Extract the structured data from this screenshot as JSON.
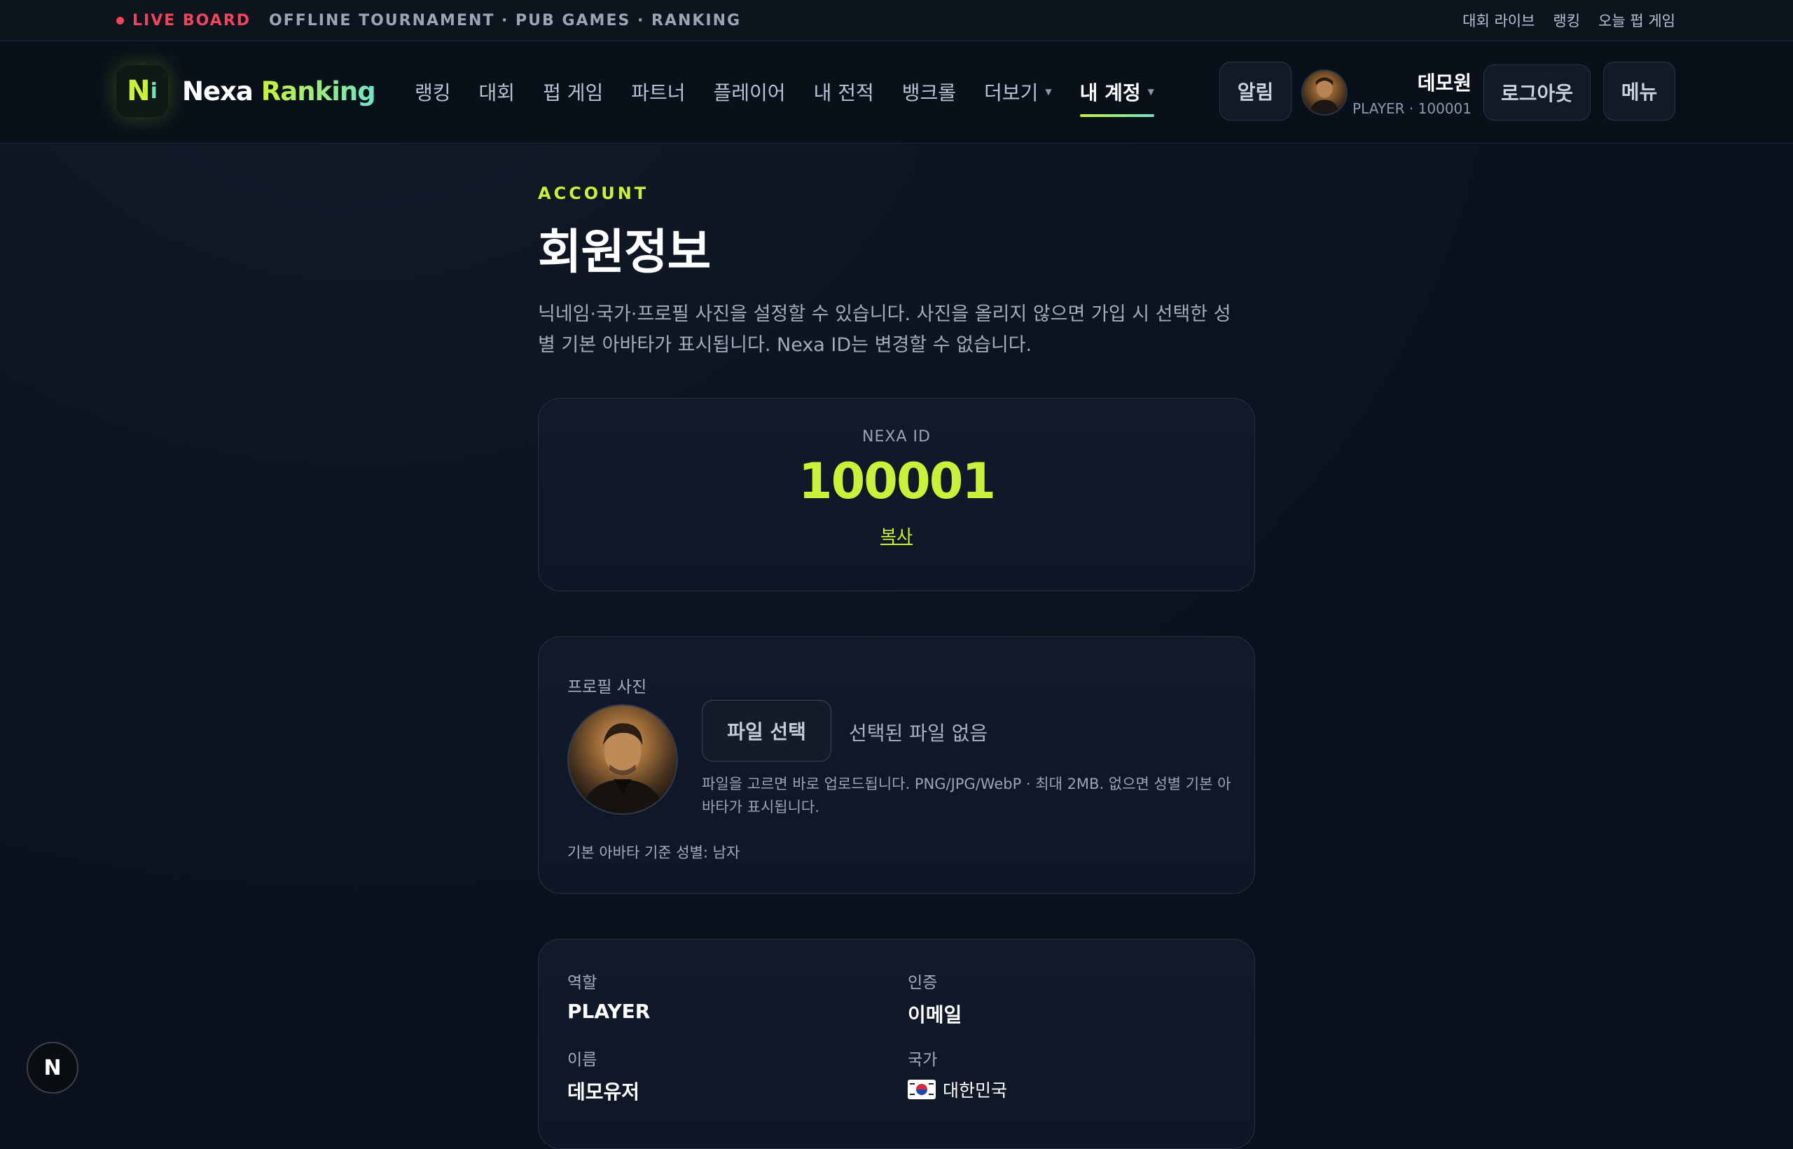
{
  "topbar": {
    "live_label": "LIVE BOARD",
    "ticker": "OFFLINE TOURNAMENT · PUB GAMES · RANKING",
    "links": [
      "대회 라이브",
      "랭킹",
      "오늘 펍 게임"
    ]
  },
  "header": {
    "logo_mark_n": "N",
    "logo_mark_i": "i",
    "logo_word_a": "Nexa",
    "logo_word_b": "Ranking",
    "nav": [
      "랭킹",
      "대회",
      "펍 게임",
      "파트너",
      "플레이어",
      "내 전적",
      "뱅크롤"
    ],
    "more_label": "더보기",
    "account_label": "내 계정",
    "alert_label": "알림",
    "user_name": "데모원",
    "user_meta": "PLAYER · 100001",
    "logout_label": "로그아웃",
    "menu_label": "메뉴"
  },
  "page": {
    "eyebrow": "ACCOUNT",
    "title": "회원정보",
    "description": "닉네임·국가·프로필 사진을 설정할 수 있습니다. 사진을 올리지 않으면 가입 시 선택한 성별 기본 아바타가 표시됩니다. Nexa ID는 변경할 수 없습니다."
  },
  "id_card": {
    "label": "NEXA ID",
    "value": "100001",
    "copy_label": "복사"
  },
  "photo_card": {
    "label": "프로필 사진",
    "file_button": "파일 선택",
    "file_status": "선택된 파일 없음",
    "help": "파일을 고르면 바로 업로드됩니다. PNG/JPG/WebP · 최대 2MB. 없으면 성별 기본 아바타가 표시됩니다.",
    "gender_note": "기본 아바타 기준 성별: 남자"
  },
  "info_card": {
    "role_label": "역할",
    "role_value": "PLAYER",
    "auth_label": "인증",
    "auth_value": "이메일",
    "name_label": "이름",
    "name_value": "데모유저",
    "country_label": "국가",
    "country_value": "대한민국"
  },
  "fab": {
    "label": "N"
  },
  "colors": {
    "accent": "#c8f23a",
    "accent_teal": "#6fe3c8",
    "live": "#f2455b",
    "background": "#0b111d"
  }
}
